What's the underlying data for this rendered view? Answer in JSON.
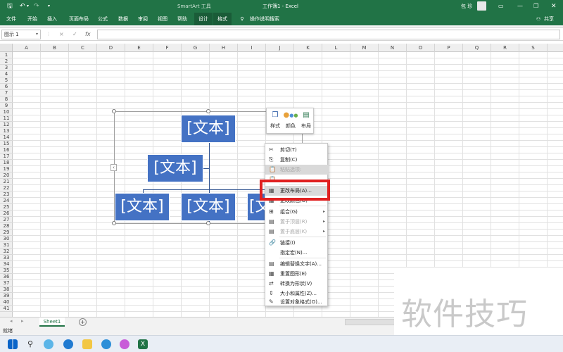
{
  "titlebar": {
    "save_icon": "save-icon",
    "undo_icon": "undo-icon",
    "redo_icon": "redo-icon",
    "customize_icon": "customize-qat-icon",
    "context_tool": "SmartArt 工具",
    "doc_title": "工作簿1  -  Excel",
    "user": "包 珍",
    "window_controls": [
      "ribbon-display-icon",
      "minimize-icon",
      "restore-icon",
      "close-icon"
    ]
  },
  "tabs": [
    "文件",
    "开始",
    "插入",
    "页面布局",
    "公式",
    "数据",
    "审阅",
    "视图",
    "帮助",
    "设计",
    "格式"
  ],
  "tell_me": "操作说明搜索",
  "share": "共享",
  "formula_bar": {
    "name_box": "图示 1",
    "cancel_icon": "×",
    "enter_icon": "✓",
    "fx_label": "fx",
    "value": ""
  },
  "columns": [
    "A",
    "B",
    "C",
    "D",
    "E",
    "F",
    "G",
    "H",
    "I",
    "J",
    "K",
    "L",
    "M",
    "N",
    "O",
    "P",
    "Q",
    "R",
    "S"
  ],
  "rows": [
    "1",
    "2",
    "3",
    "4",
    "5",
    "6",
    "7",
    "8",
    "9",
    "10",
    "11",
    "12",
    "13",
    "14",
    "15",
    "16",
    "17",
    "18",
    "19",
    "20",
    "21",
    "22",
    "23",
    "24",
    "25",
    "26",
    "27",
    "28",
    "29",
    "30",
    "31",
    "32",
    "33",
    "34",
    "35",
    "36",
    "37",
    "38",
    "39",
    "40",
    "41"
  ],
  "smartart": {
    "boxes": [
      "[文本]",
      "[文本]",
      "[文本]",
      "[文本]",
      "[文"
    ],
    "collapse_icon": "‹"
  },
  "mini_toolbar": [
    {
      "label": "样式",
      "icon": "style-icon"
    },
    {
      "label": "颜色",
      "icon": "color-icon"
    },
    {
      "label": "布局",
      "icon": "layout-icon"
    }
  ],
  "context_menu": {
    "items": [
      {
        "label": "剪切(T)",
        "icon": "✂",
        "state": "normal"
      },
      {
        "label": "复制(C)",
        "icon": "⎘",
        "state": "normal"
      },
      {
        "label": "粘贴选项:",
        "icon": "📋",
        "state": "disabled"
      },
      {
        "label": "",
        "icon": "📋",
        "state": "disabled"
      },
      {
        "label": "更改布局(A)...",
        "icon": "▦",
        "state": "highlighted"
      },
      {
        "label": "更改颜色(O)",
        "icon": "▦",
        "state": "normal"
      },
      {
        "label": "组合(G)",
        "icon": "⊞",
        "state": "submenu"
      },
      {
        "label": "置于顶层(R)",
        "icon": "▤",
        "state": "disabled-submenu"
      },
      {
        "label": "置于底层(K)",
        "icon": "▤",
        "state": "disabled-submenu"
      },
      {
        "label": "链接(I)",
        "icon": "🔗",
        "state": "normal"
      },
      {
        "label": "指定宏(N)...",
        "icon": "",
        "state": "normal"
      },
      {
        "label": "编辑替换文字(A)...",
        "icon": "▤",
        "state": "normal"
      },
      {
        "label": "重置图形(E)",
        "icon": "▦",
        "state": "normal"
      },
      {
        "label": "转换为形状(V)",
        "icon": "⇄",
        "state": "normal"
      },
      {
        "label": "大小和属性(Z)...",
        "icon": "⇕",
        "state": "normal"
      },
      {
        "label": "设置对象格式(O)...",
        "icon": "✎",
        "state": "normal"
      }
    ],
    "submenu_arrow": "▸"
  },
  "sheets": {
    "tab": "Sheet1",
    "add_icon": "+",
    "nav_prev": "◂",
    "nav_next": "▸"
  },
  "status": {
    "text": "就绪"
  },
  "taskbar_icons": [
    "windows-start-icon",
    "search-icon",
    "edge-icon",
    "edge-icon",
    "file-explorer-icon",
    "app-icon",
    "browser-icon",
    "excel-icon"
  ],
  "watermark": "软件技巧",
  "colors": {
    "excel_green": "#217346",
    "smartart_blue": "#4472c4",
    "highlight_red": "#e02020"
  }
}
